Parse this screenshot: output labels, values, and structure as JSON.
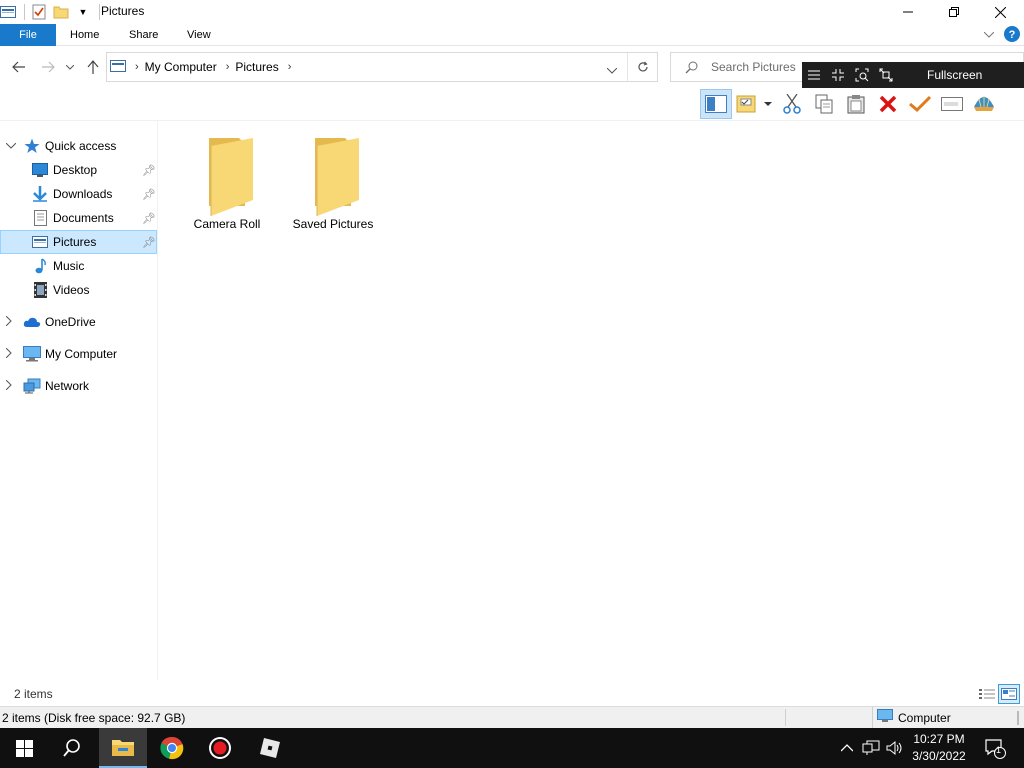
{
  "window": {
    "title": "Pictures"
  },
  "ribbon": {
    "tabs": [
      "File",
      "Home",
      "Share",
      "View"
    ]
  },
  "address": {
    "crumbs": [
      "My Computer",
      "Pictures"
    ]
  },
  "search": {
    "placeholder": "Search Pictures"
  },
  "overlay": {
    "fullscreen_label": "Fullscreen"
  },
  "toolbar": {
    "icons": [
      "preview-pane-icon",
      "properties-icon",
      "cut-icon",
      "copy-icon",
      "paste-icon",
      "delete-icon",
      "checkmark-icon",
      "rename-icon",
      "shell-icon"
    ]
  },
  "nav": {
    "quick_access": "Quick access",
    "quick_items": [
      {
        "label": "Desktop",
        "icon": "desktop-icon",
        "pinned": true
      },
      {
        "label": "Downloads",
        "icon": "downloads-icon",
        "pinned": true
      },
      {
        "label": "Documents",
        "icon": "documents-icon",
        "pinned": true
      },
      {
        "label": "Pictures",
        "icon": "pictures-icon",
        "pinned": true,
        "selected": true
      },
      {
        "label": "Music",
        "icon": "music-icon",
        "pinned": false
      },
      {
        "label": "Videos",
        "icon": "videos-icon",
        "pinned": false
      }
    ],
    "roots": [
      {
        "label": "OneDrive",
        "icon": "onedrive-icon"
      },
      {
        "label": "My Computer",
        "icon": "computer-icon"
      },
      {
        "label": "Network",
        "icon": "network-icon"
      }
    ]
  },
  "content": {
    "folders": [
      "Camera Roll",
      "Saved Pictures"
    ]
  },
  "status": {
    "item_count": "2 items",
    "details_left": "2 items (Disk free space: 92.7 GB)",
    "details_right": "Computer"
  },
  "taskbar": {
    "time": "10:27 PM",
    "date": "3/30/2022",
    "notification_count": "1"
  },
  "colors": {
    "accent": "#1979ca",
    "selection": "#cce8ff",
    "folder": "#f8d775",
    "taskbar": "#101010"
  }
}
